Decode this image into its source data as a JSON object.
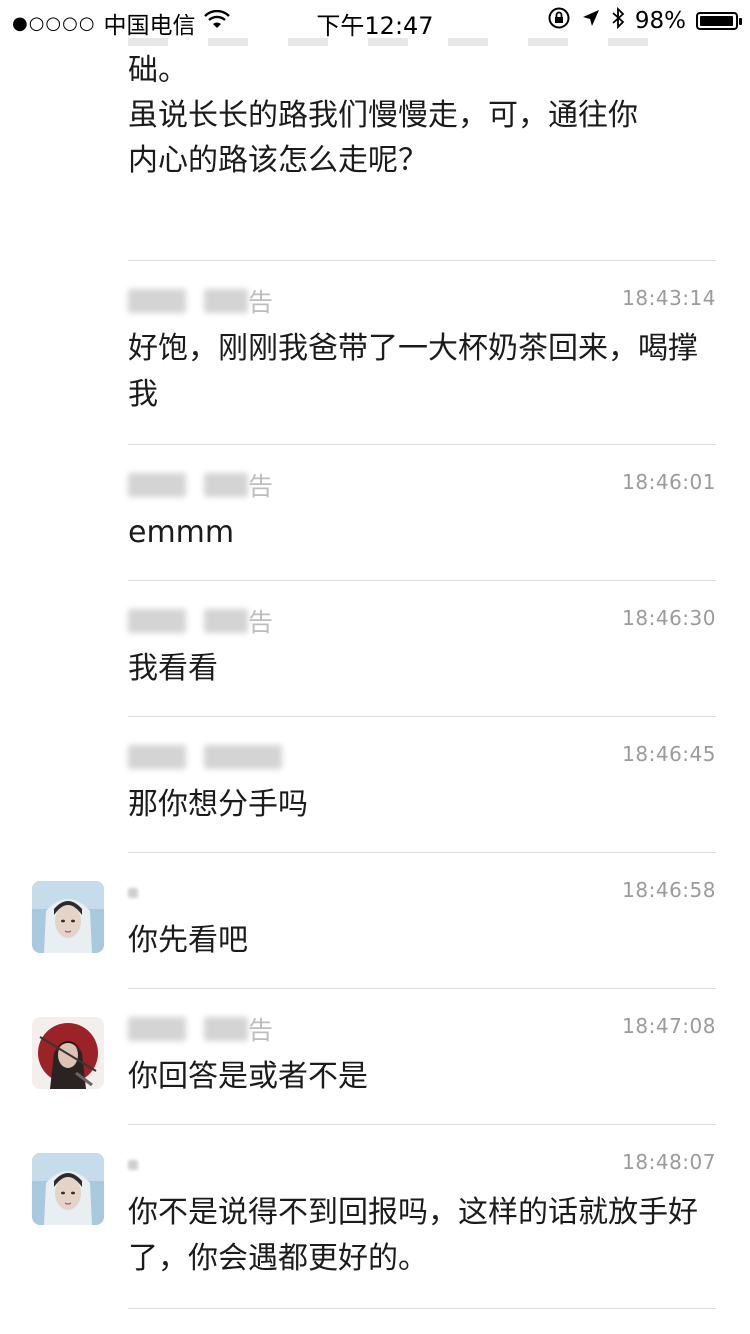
{
  "status_bar": {
    "signal_dots": "●○○○○",
    "carrier": "中国电信",
    "time": "下午12:47",
    "battery_percent": "98%",
    "battery_level": 0.98,
    "icons": [
      "wifi-icon",
      "rotation-lock-icon",
      "location-arrow-icon",
      "bluetooth-icon",
      "battery-icon"
    ]
  },
  "intro": {
    "line1": "础。",
    "line2": " 虽说长长的路我们慢慢走，可，通往你",
    "line3": "内心的路该怎么走呢？"
  },
  "messages": [
    {
      "name_suffix": "告",
      "time": "18:43:14",
      "text": "好饱，刚刚我爸带了一大杯奶茶回来，喝撑我",
      "avatar": "none"
    },
    {
      "name_suffix": "告",
      "time": "18:46:01",
      "text": "emmm",
      "avatar": "none"
    },
    {
      "name_suffix": "告",
      "time": "18:46:30",
      "text": "我看看",
      "avatar": "none"
    },
    {
      "name_suffix": "",
      "time": "18:46:45",
      "text": "那你想分手吗",
      "avatar": "none"
    },
    {
      "name_suffix": "",
      "time": "18:46:58",
      "text": "你先看吧",
      "avatar": "girl-avatar"
    },
    {
      "name_suffix": "告",
      "time": "18:47:08",
      "text": "你回答是或者不是",
      "avatar": "warrior-avatar"
    },
    {
      "name_suffix": "",
      "time": "18:48:07",
      "text": "你不是说得不到回报吗，这样的话就放手好了，你会遇都更好的。",
      "avatar": "girl-avatar"
    }
  ],
  "colors": {
    "divider": "#dcdcdc",
    "timestamp": "#9b9b9b",
    "text": "#1b1b1b"
  }
}
